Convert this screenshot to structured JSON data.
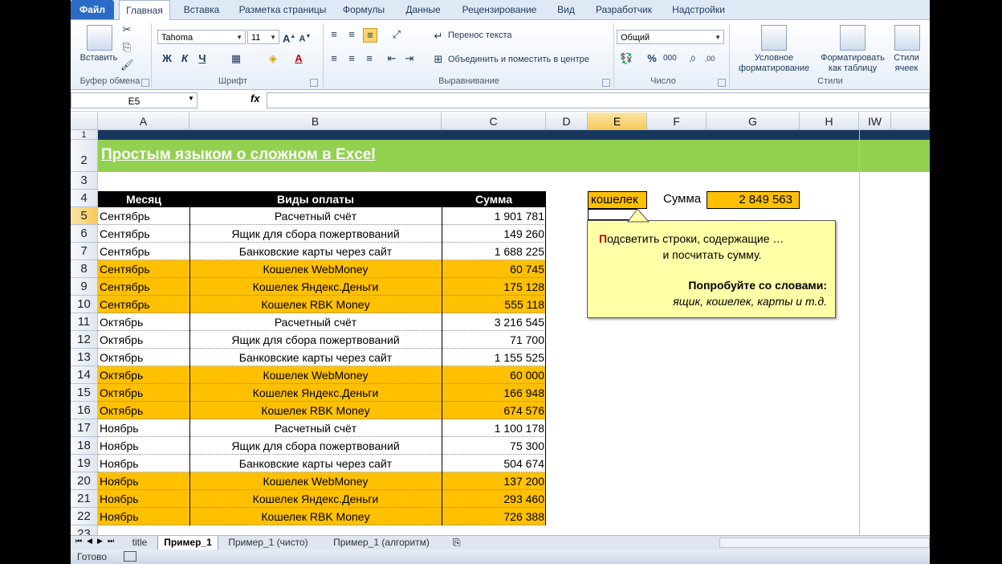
{
  "ribbon_tabs": [
    "Файл",
    "Главная",
    "Вставка",
    "Разметка страницы",
    "Формулы",
    "Данные",
    "Рецензирование",
    "Вид",
    "Разработчик",
    "Надстройки"
  ],
  "ribbon": {
    "paste_label": "Вставить",
    "clipboard_group": "Буфер обмена",
    "font_name": "Tahoma",
    "font_size": "11",
    "font_group": "Шрифт",
    "bold": "Ж",
    "italic": "К",
    "underline": "Ч",
    "wrap_text": "Перенос текста",
    "merge_center": "Объединить и поместить в центре",
    "alignment_group": "Выравнивание",
    "number_format": "Общий",
    "number_group": "Число",
    "cond_format_1": "Условное",
    "cond_format_2": "форматирование",
    "format_table_1": "Форматировать",
    "format_table_2": "как таблицу",
    "cell_styles_1": "Стили",
    "cell_styles_2": "ячеек",
    "styles_group": "Стили"
  },
  "formula_bar": {
    "name_box": "E5",
    "fx": "fx",
    "value": ""
  },
  "columns": [
    "A",
    "B",
    "C",
    "D",
    "E",
    "F",
    "G",
    "H",
    "IW"
  ],
  "selected_column": "E",
  "selected_row": "5",
  "title": "Простым языком о сложном в Excel",
  "table": {
    "headers": [
      "Месяц",
      "Виды оплаты",
      "Сумма"
    ],
    "rows": [
      {
        "row": "5",
        "month": "Сентябрь",
        "type": "Расчетный счёт",
        "sum": "1 901 781",
        "hl": false
      },
      {
        "row": "6",
        "month": "Сентябрь",
        "type": "Ящик для сбора пожертвований",
        "sum": "149 260",
        "hl": false
      },
      {
        "row": "7",
        "month": "Сентябрь",
        "type": "Банковские карты через сайт",
        "sum": "1 688 225",
        "hl": false
      },
      {
        "row": "8",
        "month": "Сентябрь",
        "type": "Кошелек WebMoney",
        "sum": "60 745",
        "hl": true
      },
      {
        "row": "9",
        "month": "Сентябрь",
        "type": "Кошелек Яндекс.Деньги",
        "sum": "175 128",
        "hl": true
      },
      {
        "row": "10",
        "month": "Сентябрь",
        "type": "Кошелек RBK Money",
        "sum": "555 118",
        "hl": true
      },
      {
        "row": "11",
        "month": "Октябрь",
        "type": "Расчетный счёт",
        "sum": "3 216 545",
        "hl": false
      },
      {
        "row": "12",
        "month": "Октябрь",
        "type": "Ящик для сбора пожертвований",
        "sum": "71 700",
        "hl": false
      },
      {
        "row": "13",
        "month": "Октябрь",
        "type": "Банковские карты через сайт",
        "sum": "1 155 525",
        "hl": false
      },
      {
        "row": "14",
        "month": "Октябрь",
        "type": "Кошелек WebMoney",
        "sum": "60 000",
        "hl": true
      },
      {
        "row": "15",
        "month": "Октябрь",
        "type": "Кошелек Яндекс.Деньги",
        "sum": "166 948",
        "hl": true
      },
      {
        "row": "16",
        "month": "Октябрь",
        "type": "Кошелек RBK Money",
        "sum": "674 576",
        "hl": true
      },
      {
        "row": "17",
        "month": "Ноябрь",
        "type": "Расчетный счёт",
        "sum": "1 100 178",
        "hl": false
      },
      {
        "row": "18",
        "month": "Ноябрь",
        "type": "Ящик для сбора пожертвований",
        "sum": "75 300",
        "hl": false
      },
      {
        "row": "19",
        "month": "Ноябрь",
        "type": "Банковские карты через сайт",
        "sum": "504 674",
        "hl": false
      },
      {
        "row": "20",
        "month": "Ноябрь",
        "type": "Кошелек WebMoney",
        "sum": "137 200",
        "hl": true
      },
      {
        "row": "21",
        "month": "Ноябрь",
        "type": "Кошелек Яндекс.Деньги",
        "sum": "293 460",
        "hl": true
      },
      {
        "row": "22",
        "month": "Ноябрь",
        "type": "Кошелек RBK Money",
        "sum": "726 388",
        "hl": true
      }
    ]
  },
  "search": {
    "keyword": "кошелек",
    "sum_label": "Сумма",
    "sum_value": "2 849 563"
  },
  "note": {
    "first_letter": "П",
    "line1_rest": "одсветить строки, содержащие …",
    "line2": "и посчитать сумму.",
    "line3": "Попробуйте со словами:",
    "line4": "ящик, кошелек, карты и т.д."
  },
  "sheet_tabs": [
    "title",
    "Пример_1",
    "Пример_1 (чисто)",
    "Пример_1 (алгоритм)"
  ],
  "active_sheet": "Пример_1",
  "status": "Готово",
  "colors": {
    "highlight": "#ffc000",
    "banner": "#92d050",
    "header": "#000000",
    "band": "#17365d"
  }
}
